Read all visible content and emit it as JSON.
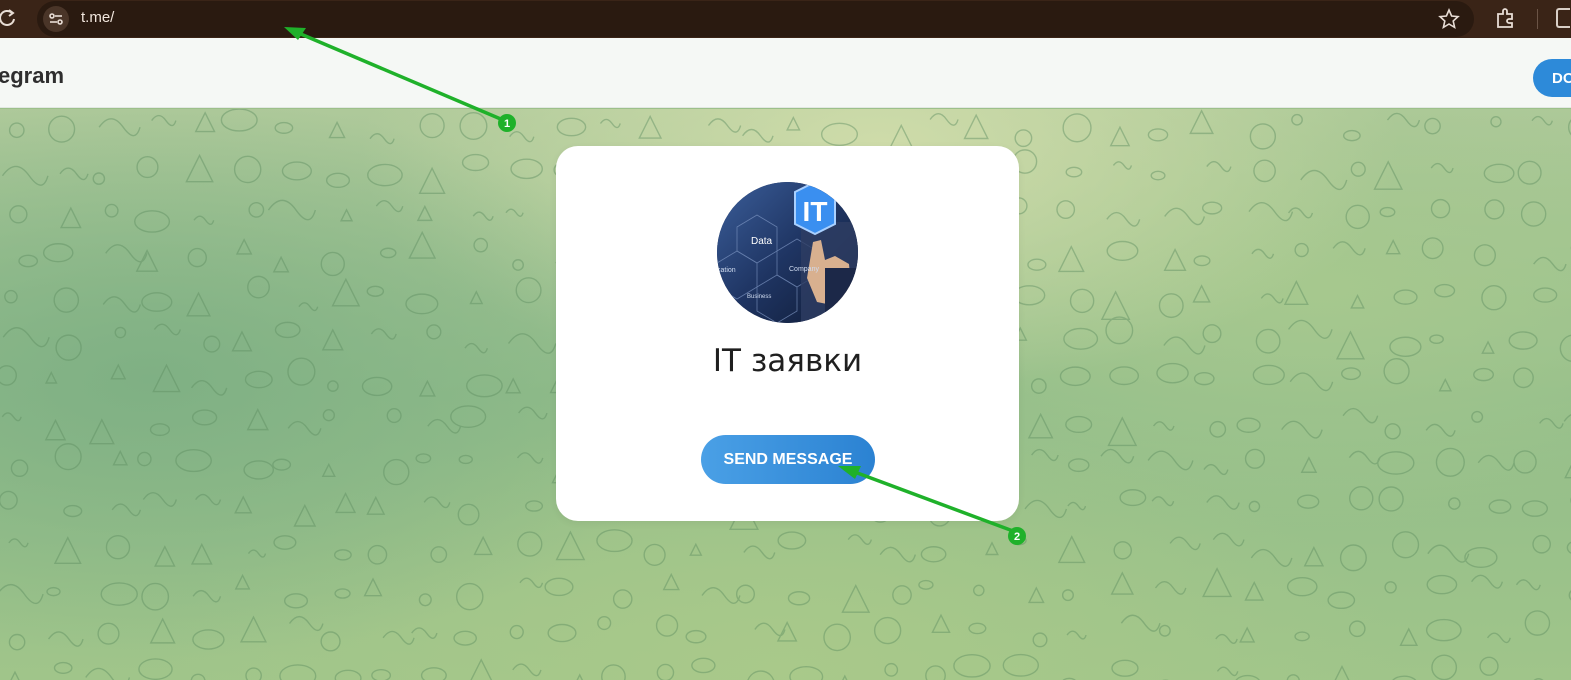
{
  "browser": {
    "url": "t.me/",
    "reload_icon": "reload-icon",
    "site_info_icon": "site-settings-icon",
    "bookmark_icon": "star-icon",
    "extensions_icon": "puzzle-icon",
    "side_panel_icon": "side-panel-icon"
  },
  "header": {
    "logo_text": "egram",
    "download_button_label": "DO"
  },
  "card": {
    "chat_title": "IT заявки",
    "send_button_label": "SEND MESSAGE",
    "avatar": {
      "badge_text": "IT",
      "words": [
        "Data",
        "cation",
        "Company",
        "Business"
      ]
    }
  },
  "annotations": [
    {
      "number": "1",
      "color": "#1fb12a"
    },
    {
      "number": "2",
      "color": "#1fb12a"
    }
  ]
}
